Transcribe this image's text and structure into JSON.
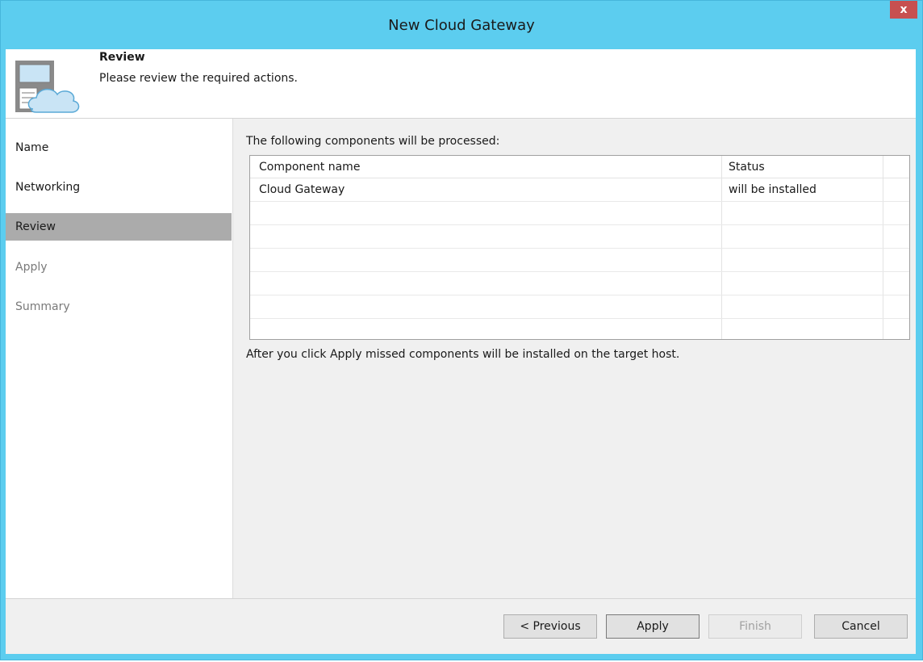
{
  "window": {
    "title": "New Cloud Gateway",
    "close_label": "x"
  },
  "header": {
    "title": "Review",
    "subtitle": "Please review the required actions."
  },
  "steps": [
    {
      "label": "Name",
      "state": "done"
    },
    {
      "label": "Networking",
      "state": "done"
    },
    {
      "label": "Review",
      "state": "active"
    },
    {
      "label": "Apply",
      "state": "disabled"
    },
    {
      "label": "Summary",
      "state": "disabled"
    }
  ],
  "content": {
    "intro": "The following components will be processed:",
    "table": {
      "columns": [
        "Component name",
        "Status"
      ],
      "rows": [
        {
          "name": "Cloud Gateway",
          "status": "will be installed"
        }
      ]
    },
    "note": "After you click Apply missed components will be installed on the target host."
  },
  "buttons": {
    "previous": "< Previous",
    "apply": "Apply",
    "finish": "Finish",
    "cancel": "Cancel"
  },
  "colors": {
    "title_bar": "#5ccdef",
    "close_button": "#c75050",
    "active_step": "#ababab"
  },
  "icons": {
    "header": "server-cloud-icon",
    "close": "close-icon"
  }
}
